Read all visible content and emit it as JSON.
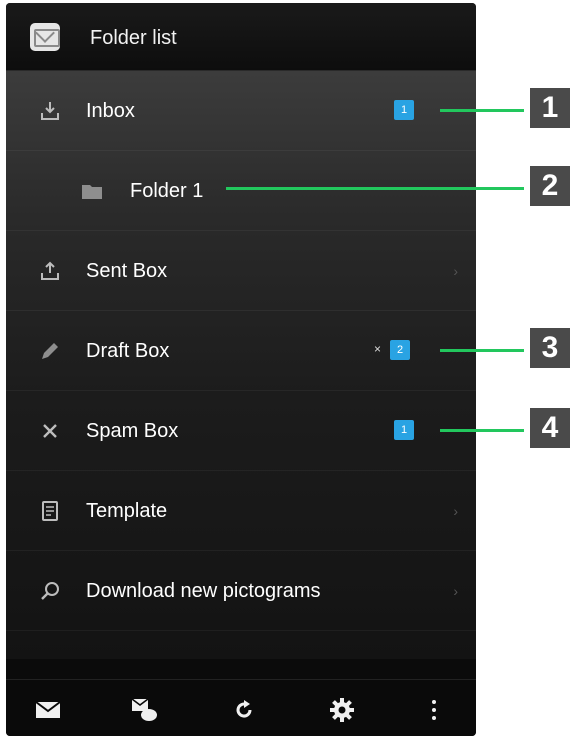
{
  "header": {
    "app_icon": "mail-app-icon",
    "title": "Folder list"
  },
  "folders": [
    {
      "label": "Inbox",
      "icon": "download-tray-icon",
      "badge": "1"
    },
    {
      "label": "Folder 1",
      "icon": "folder-icon"
    },
    {
      "label": "Sent Box",
      "icon": "upload-tray-icon"
    },
    {
      "label": "Draft Box",
      "icon": "pencil-icon",
      "badge": "2",
      "marker": "×"
    },
    {
      "label": "Spam Box",
      "icon": "x-icon",
      "badge": "1"
    },
    {
      "label": "Template",
      "icon": "document-icon"
    },
    {
      "label": "Download new pictograms",
      "icon": "search-icon"
    }
  ],
  "toolbar": {
    "icons": [
      "envelope-icon",
      "compose-icon",
      "refresh-icon",
      "gear-icon",
      "overflow-menu-icon"
    ]
  },
  "callouts": [
    "1",
    "2",
    "3",
    "4"
  ],
  "colors": {
    "badge": "#29a3e3",
    "callout_line": "#22c75d",
    "callout_box": "#4a4a4a"
  }
}
